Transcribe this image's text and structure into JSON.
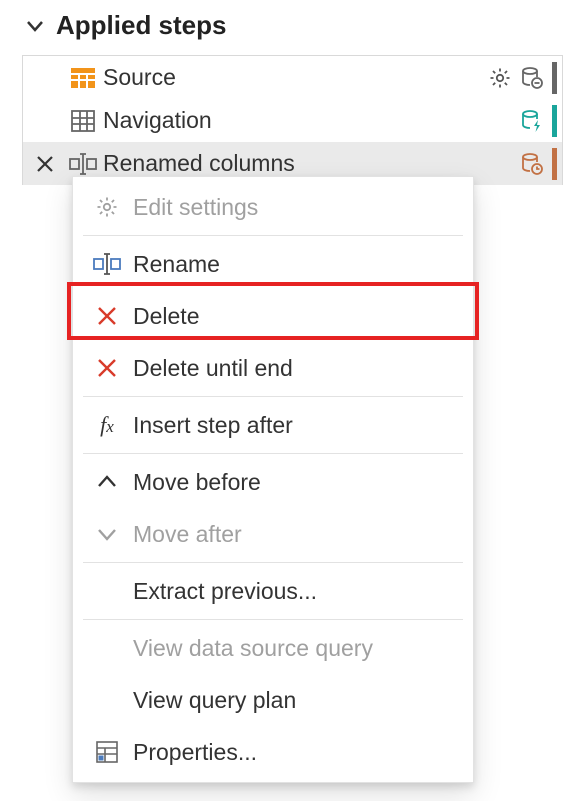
{
  "panel": {
    "title": "Applied steps"
  },
  "steps": [
    {
      "label": "Source"
    },
    {
      "label": "Navigation"
    },
    {
      "label": "Renamed columns"
    }
  ],
  "menu": {
    "edit_settings": "Edit settings",
    "rename": "Rename",
    "delete": "Delete",
    "delete_until_end": "Delete until end",
    "insert_step_after": "Insert step after",
    "move_before": "Move before",
    "move_after": "Move after",
    "extract_previous": "Extract previous...",
    "view_data_source_query": "View data source query",
    "view_query_plan": "View query plan",
    "properties": "Properties..."
  },
  "colors": {
    "orange": "#f2941a",
    "grey": "#666666",
    "teal": "#1aa59b",
    "brown": "#c27144",
    "red": "#e62222"
  }
}
